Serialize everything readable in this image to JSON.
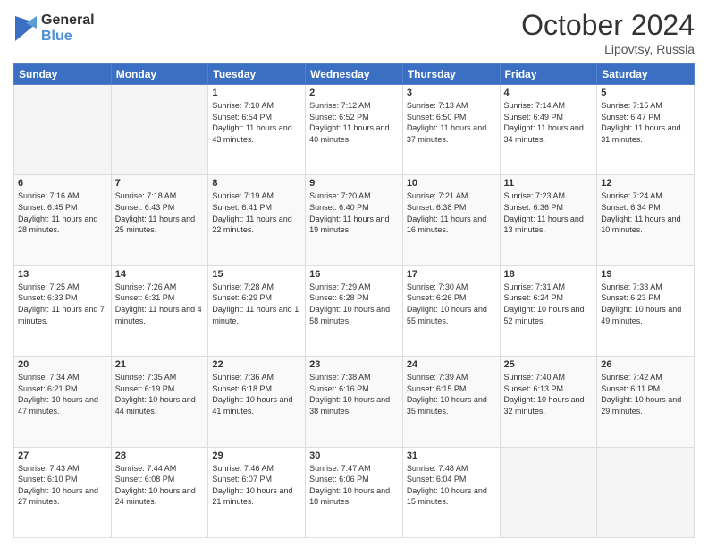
{
  "logo": {
    "general": "General",
    "blue": "Blue"
  },
  "header": {
    "month": "October 2024",
    "location": "Lipovtsy, Russia"
  },
  "days_of_week": [
    "Sunday",
    "Monday",
    "Tuesday",
    "Wednesday",
    "Thursday",
    "Friday",
    "Saturday"
  ],
  "weeks": [
    [
      {
        "day": "",
        "sunrise": "",
        "sunset": "",
        "daylight": ""
      },
      {
        "day": "",
        "sunrise": "",
        "sunset": "",
        "daylight": ""
      },
      {
        "day": "1",
        "sunrise": "Sunrise: 7:10 AM",
        "sunset": "Sunset: 6:54 PM",
        "daylight": "Daylight: 11 hours and 43 minutes."
      },
      {
        "day": "2",
        "sunrise": "Sunrise: 7:12 AM",
        "sunset": "Sunset: 6:52 PM",
        "daylight": "Daylight: 11 hours and 40 minutes."
      },
      {
        "day": "3",
        "sunrise": "Sunrise: 7:13 AM",
        "sunset": "Sunset: 6:50 PM",
        "daylight": "Daylight: 11 hours and 37 minutes."
      },
      {
        "day": "4",
        "sunrise": "Sunrise: 7:14 AM",
        "sunset": "Sunset: 6:49 PM",
        "daylight": "Daylight: 11 hours and 34 minutes."
      },
      {
        "day": "5",
        "sunrise": "Sunrise: 7:15 AM",
        "sunset": "Sunset: 6:47 PM",
        "daylight": "Daylight: 11 hours and 31 minutes."
      }
    ],
    [
      {
        "day": "6",
        "sunrise": "Sunrise: 7:16 AM",
        "sunset": "Sunset: 6:45 PM",
        "daylight": "Daylight: 11 hours and 28 minutes."
      },
      {
        "day": "7",
        "sunrise": "Sunrise: 7:18 AM",
        "sunset": "Sunset: 6:43 PM",
        "daylight": "Daylight: 11 hours and 25 minutes."
      },
      {
        "day": "8",
        "sunrise": "Sunrise: 7:19 AM",
        "sunset": "Sunset: 6:41 PM",
        "daylight": "Daylight: 11 hours and 22 minutes."
      },
      {
        "day": "9",
        "sunrise": "Sunrise: 7:20 AM",
        "sunset": "Sunset: 6:40 PM",
        "daylight": "Daylight: 11 hours and 19 minutes."
      },
      {
        "day": "10",
        "sunrise": "Sunrise: 7:21 AM",
        "sunset": "Sunset: 6:38 PM",
        "daylight": "Daylight: 11 hours and 16 minutes."
      },
      {
        "day": "11",
        "sunrise": "Sunrise: 7:23 AM",
        "sunset": "Sunset: 6:36 PM",
        "daylight": "Daylight: 11 hours and 13 minutes."
      },
      {
        "day": "12",
        "sunrise": "Sunrise: 7:24 AM",
        "sunset": "Sunset: 6:34 PM",
        "daylight": "Daylight: 11 hours and 10 minutes."
      }
    ],
    [
      {
        "day": "13",
        "sunrise": "Sunrise: 7:25 AM",
        "sunset": "Sunset: 6:33 PM",
        "daylight": "Daylight: 11 hours and 7 minutes."
      },
      {
        "day": "14",
        "sunrise": "Sunrise: 7:26 AM",
        "sunset": "Sunset: 6:31 PM",
        "daylight": "Daylight: 11 hours and 4 minutes."
      },
      {
        "day": "15",
        "sunrise": "Sunrise: 7:28 AM",
        "sunset": "Sunset: 6:29 PM",
        "daylight": "Daylight: 11 hours and 1 minute."
      },
      {
        "day": "16",
        "sunrise": "Sunrise: 7:29 AM",
        "sunset": "Sunset: 6:28 PM",
        "daylight": "Daylight: 10 hours and 58 minutes."
      },
      {
        "day": "17",
        "sunrise": "Sunrise: 7:30 AM",
        "sunset": "Sunset: 6:26 PM",
        "daylight": "Daylight: 10 hours and 55 minutes."
      },
      {
        "day": "18",
        "sunrise": "Sunrise: 7:31 AM",
        "sunset": "Sunset: 6:24 PM",
        "daylight": "Daylight: 10 hours and 52 minutes."
      },
      {
        "day": "19",
        "sunrise": "Sunrise: 7:33 AM",
        "sunset": "Sunset: 6:23 PM",
        "daylight": "Daylight: 10 hours and 49 minutes."
      }
    ],
    [
      {
        "day": "20",
        "sunrise": "Sunrise: 7:34 AM",
        "sunset": "Sunset: 6:21 PM",
        "daylight": "Daylight: 10 hours and 47 minutes."
      },
      {
        "day": "21",
        "sunrise": "Sunrise: 7:35 AM",
        "sunset": "Sunset: 6:19 PM",
        "daylight": "Daylight: 10 hours and 44 minutes."
      },
      {
        "day": "22",
        "sunrise": "Sunrise: 7:36 AM",
        "sunset": "Sunset: 6:18 PM",
        "daylight": "Daylight: 10 hours and 41 minutes."
      },
      {
        "day": "23",
        "sunrise": "Sunrise: 7:38 AM",
        "sunset": "Sunset: 6:16 PM",
        "daylight": "Daylight: 10 hours and 38 minutes."
      },
      {
        "day": "24",
        "sunrise": "Sunrise: 7:39 AM",
        "sunset": "Sunset: 6:15 PM",
        "daylight": "Daylight: 10 hours and 35 minutes."
      },
      {
        "day": "25",
        "sunrise": "Sunrise: 7:40 AM",
        "sunset": "Sunset: 6:13 PM",
        "daylight": "Daylight: 10 hours and 32 minutes."
      },
      {
        "day": "26",
        "sunrise": "Sunrise: 7:42 AM",
        "sunset": "Sunset: 6:11 PM",
        "daylight": "Daylight: 10 hours and 29 minutes."
      }
    ],
    [
      {
        "day": "27",
        "sunrise": "Sunrise: 7:43 AM",
        "sunset": "Sunset: 6:10 PM",
        "daylight": "Daylight: 10 hours and 27 minutes."
      },
      {
        "day": "28",
        "sunrise": "Sunrise: 7:44 AM",
        "sunset": "Sunset: 6:08 PM",
        "daylight": "Daylight: 10 hours and 24 minutes."
      },
      {
        "day": "29",
        "sunrise": "Sunrise: 7:46 AM",
        "sunset": "Sunset: 6:07 PM",
        "daylight": "Daylight: 10 hours and 21 minutes."
      },
      {
        "day": "30",
        "sunrise": "Sunrise: 7:47 AM",
        "sunset": "Sunset: 6:06 PM",
        "daylight": "Daylight: 10 hours and 18 minutes."
      },
      {
        "day": "31",
        "sunrise": "Sunrise: 7:48 AM",
        "sunset": "Sunset: 6:04 PM",
        "daylight": "Daylight: 10 hours and 15 minutes."
      },
      {
        "day": "",
        "sunrise": "",
        "sunset": "",
        "daylight": ""
      },
      {
        "day": "",
        "sunrise": "",
        "sunset": "",
        "daylight": ""
      }
    ]
  ]
}
